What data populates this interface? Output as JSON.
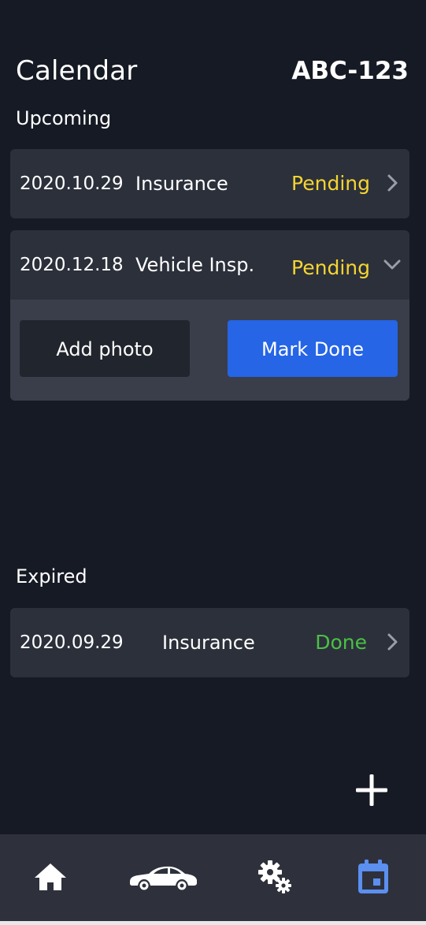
{
  "header": {
    "title": "Calendar",
    "plate": "ABC-123"
  },
  "sections": {
    "upcoming_label": "Upcoming",
    "expired_label": "Expired"
  },
  "upcoming": [
    {
      "date": "2020.10.29",
      "name": "Insurance",
      "status": "Pending",
      "expanded": false
    },
    {
      "date": "2020.12.18",
      "name": "Vehicle Insp.",
      "status": "Pending",
      "expanded": true
    }
  ],
  "expanded_actions": {
    "add_photo": "Add photo",
    "mark_done": "Mark Done"
  },
  "expired": [
    {
      "date": "2020.09.29",
      "name": "Insurance",
      "status": "Done"
    }
  ],
  "nav": {
    "items": [
      "home-icon",
      "car-icon",
      "settings-icon",
      "calendar-icon"
    ],
    "active": "calendar-icon"
  },
  "colors": {
    "background": "#161a24",
    "card": "#2c303b",
    "pending": "#f5d531",
    "done": "#4bc045",
    "accent": "#2565e6",
    "nav_active": "#5b8ff0"
  }
}
